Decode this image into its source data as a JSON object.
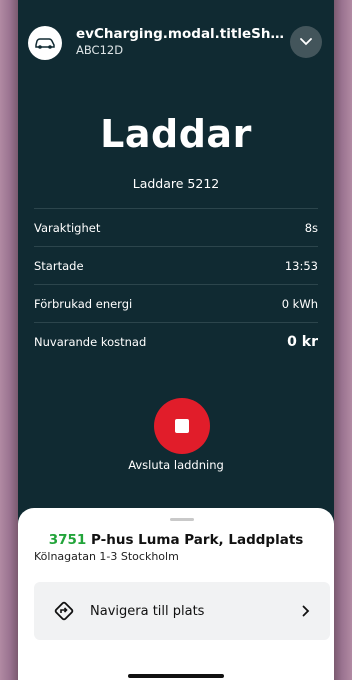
{
  "header": {
    "modal_title": "evCharging.modal.titleShe...",
    "plate": "ABC12D",
    "avatar_icon": "car-icon",
    "toggle_icon": "chevron-down-icon"
  },
  "status": {
    "title": "Laddar",
    "charger": "Laddare 5212"
  },
  "rows": [
    {
      "label": "Varaktighet",
      "value": "8s"
    },
    {
      "label": "Startade",
      "value": "13:53"
    },
    {
      "label": "Förbrukad energi",
      "value": "0 kWh"
    },
    {
      "label": "Nuvarande kostnad",
      "value": "0 kr"
    }
  ],
  "stop": {
    "label": "Avsluta laddning",
    "icon": "stop-icon",
    "color": "#e11d2a"
  },
  "location": {
    "number": "3751",
    "name": "P-hus Luma Park, Laddplats",
    "address": "Kölnagatan 1-3 Stockholm"
  },
  "navigate": {
    "label": "Navigera till plats",
    "icon": "directions-icon",
    "arrow_icon": "chevron-right-icon"
  },
  "colors": {
    "background": "#102a32",
    "accent_green": "#22a43a",
    "stop_red": "#e11d2a"
  }
}
